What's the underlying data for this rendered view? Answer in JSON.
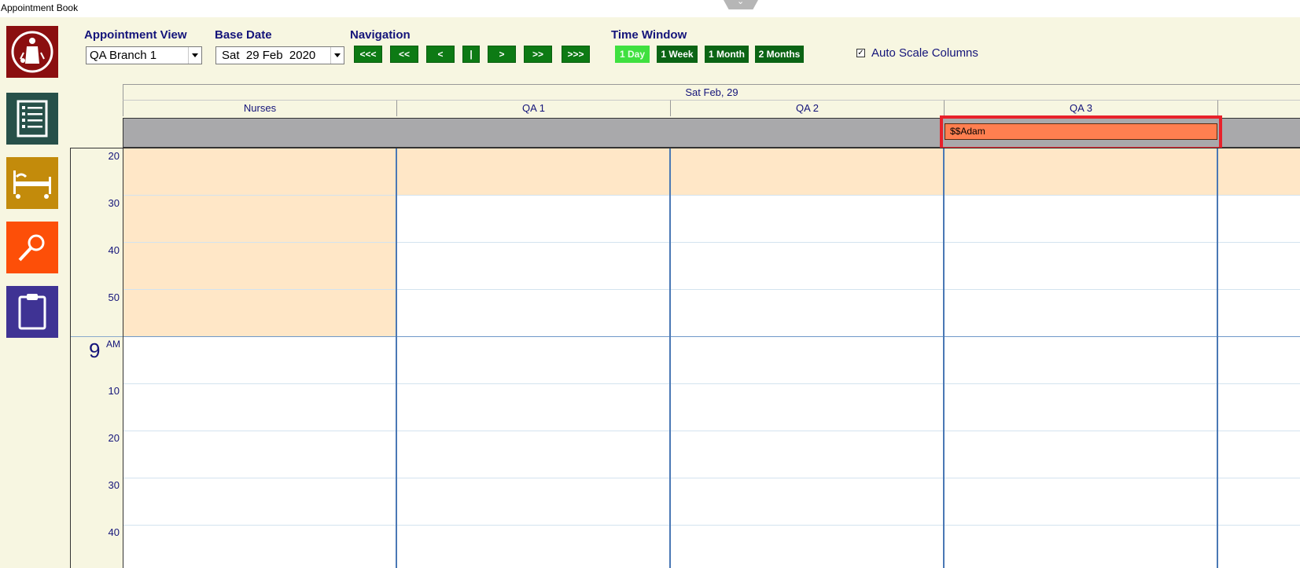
{
  "window": {
    "title": "Appointment Book"
  },
  "sidebar": {
    "buttons": [
      {
        "name": "organisation-logo",
        "color": "#8b0f10"
      },
      {
        "name": "list-icon",
        "color": "#275049"
      },
      {
        "name": "hospital-bed-icon",
        "color": "#c38b0b"
      },
      {
        "name": "search-icon",
        "color": "#fd4f08"
      },
      {
        "name": "clipboard-icon",
        "color": "#3f3394"
      }
    ]
  },
  "toolbar": {
    "appointment_view": {
      "label": "Appointment View",
      "value": "QA Branch 1"
    },
    "base_date": {
      "label": "Base Date",
      "value": "Sat  29 Feb  2020"
    },
    "navigation": {
      "label": "Navigation",
      "buttons": [
        "<<<",
        "<<",
        "<",
        "|",
        ">",
        ">>",
        ">>>"
      ]
    },
    "time_window": {
      "label": "Time Window",
      "buttons": [
        "1 Day",
        "1 Week",
        "1 Month",
        "2 Months"
      ],
      "active": "1 Day"
    },
    "auto_scale": {
      "label": "Auto Scale Columns",
      "checked": true,
      "mark": "✓"
    }
  },
  "calendar": {
    "date_header": "Sat Feb, 29",
    "columns": [
      "Nurses",
      "QA 1",
      "QA 2",
      "QA 3"
    ],
    "all_day_appointment": {
      "column": "QA 3",
      "text": "$$Adam",
      "color": "#ff7f50"
    },
    "time_labels": {
      "minutes_before": [
        "20",
        "30",
        "40",
        "50"
      ],
      "hour": "9",
      "ampm": "AM",
      "minutes_after": [
        "10",
        "20",
        "30",
        "40"
      ]
    },
    "colors": {
      "busy": "#ffe7c7",
      "column_divider": "#4a78b5",
      "highlight": "#e8212a"
    }
  }
}
